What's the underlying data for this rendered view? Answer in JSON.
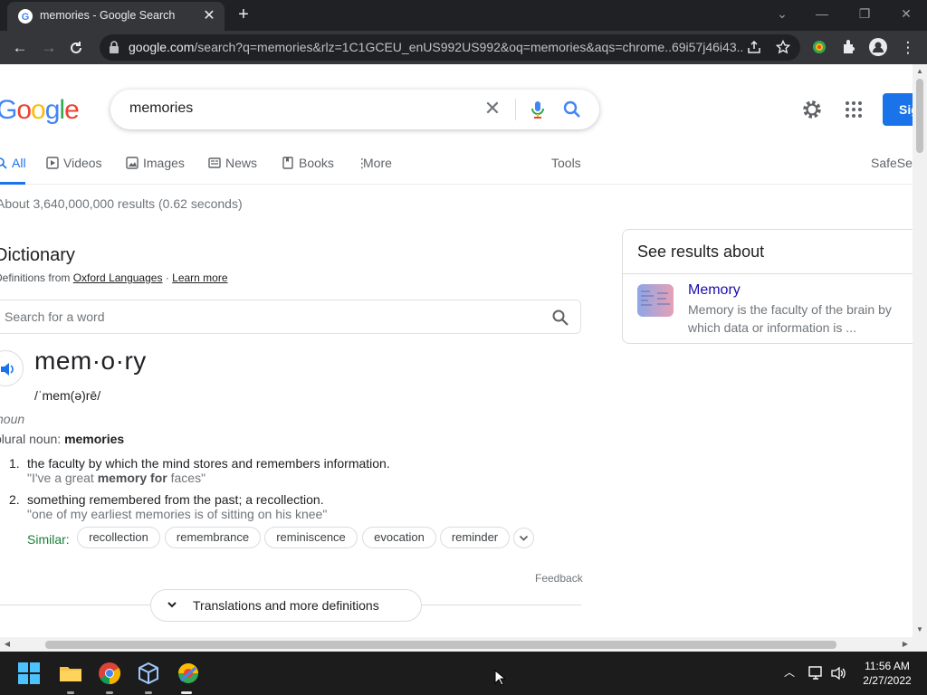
{
  "browser": {
    "tab_title": "memories - Google Search",
    "tab_close": "✕",
    "new_tab": "+",
    "url_host": "google.com",
    "url_rest": "/search?q=memories&rlz=1C1GCEU_enUS992US992&oq=memories&aqs=chrome..69i57j46i43..."
  },
  "search": {
    "logo": "Google",
    "query": "memories",
    "signin_label": "Sign in",
    "tabs": [
      {
        "label": "All"
      },
      {
        "label": "Videos"
      },
      {
        "label": "Images"
      },
      {
        "label": "News"
      },
      {
        "label": "Books"
      },
      {
        "label": "More"
      }
    ],
    "tools_label": "Tools",
    "safesearch_label": "SafeSearch",
    "result_stats": "About 3,640,000,000 results (0.62 seconds)"
  },
  "dictionary": {
    "title": "Dictionary",
    "from_prefix": "Definitions from",
    "source": "Oxford Languages",
    "separator": "·",
    "learn_more": "Learn more",
    "search_placeholder": "Search for a word",
    "headword": "mem·o·ry",
    "phonetic": "/ˈmem(ə)rē/",
    "pos": "noun",
    "plural_label": "plural noun:",
    "plural_word": "memories",
    "definitions": [
      {
        "num": "1.",
        "text": "the faculty by which the mind stores and remembers information.",
        "example_pre": "\"I've a great ",
        "example_bold": "memory for",
        "example_post": " faces\""
      },
      {
        "num": "2.",
        "text": "something remembered from the past; a recollection.",
        "example_pre": "\"one of my earliest memories is of sitting on his knee\"",
        "example_bold": "",
        "example_post": ""
      }
    ],
    "similar_label": "Similar:",
    "similar": [
      "recollection",
      "remembrance",
      "reminiscence",
      "evocation",
      "reminder"
    ],
    "feedback": "Feedback",
    "translations_button": "Translations and more definitions"
  },
  "side_panel": {
    "title": "See results about",
    "entity_name": "Memory",
    "entity_desc": "Memory is the faculty of the brain by which data or information is ..."
  },
  "taskbar": {
    "time": "11:56 AM",
    "date": "2/27/2022"
  },
  "colors": {
    "accent": "#1a73e8",
    "link": "#1a0dab",
    "similar_green": "#188038"
  }
}
